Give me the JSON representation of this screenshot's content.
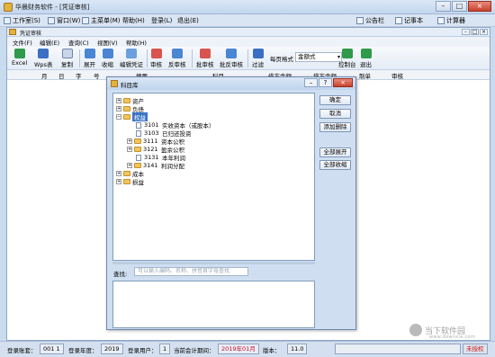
{
  "window": {
    "title": "华晨财务软件 - [凭证审核]"
  },
  "main_menu": [
    "工作室(S)",
    "窗口(W)",
    "主菜单(M)",
    "帮助(H)",
    "登录(L)",
    "退出(E)"
  ],
  "right_apps": [
    "公告栏",
    "记事本",
    "计算器"
  ],
  "doc_window": {
    "title": "凭证审核"
  },
  "sub_menu": [
    "文件(F)",
    "编辑(E)",
    "查询(C)",
    "视图(V)",
    "帮助(H)"
  ],
  "toolbar": {
    "buttons": [
      "Excel",
      "Wps表",
      "复制",
      "展开",
      "收缩",
      "编辑凭证",
      "审核",
      "反审核",
      "批审核",
      "批反审核",
      "过滤"
    ],
    "page_format_label": "每页格式",
    "format_value": "金额式",
    "right_buttons": [
      "控制台",
      "退出"
    ]
  },
  "columns": [
    "月",
    "日",
    "字",
    "号",
    "摘要",
    "科目",
    "借方金额",
    "贷方金额",
    "制单",
    "审核"
  ],
  "dialog": {
    "title": "科目库",
    "tree": [
      {
        "label": "资产",
        "expander": "+"
      },
      {
        "label": "负债",
        "expander": "+"
      },
      {
        "label": "权益",
        "expander": "−",
        "selected": true
      },
      {
        "code": "3101",
        "label": "实收资本（或股本）"
      },
      {
        "code": "3103",
        "label": "已归还投资"
      },
      {
        "code": "3111",
        "label": "资本公积",
        "expander": "+"
      },
      {
        "code": "3121",
        "label": "盈余公积",
        "expander": "+"
      },
      {
        "code": "3131",
        "label": "本年利润"
      },
      {
        "code": "3141",
        "label": "利润分配",
        "expander": "+"
      },
      {
        "label": "成本",
        "expander": "+"
      },
      {
        "label": "损益",
        "expander": "+"
      }
    ],
    "search_label": "查找:",
    "search_placeholder": "可以输入编码、名称、拼音首字母查找",
    "buttons": [
      "确定",
      "取消",
      "添加删除",
      "全部展开",
      "全部收缩"
    ]
  },
  "status": {
    "account_label": "登录账套：",
    "account_value": "001 1",
    "year_label": "登录年度：",
    "year_value": "2019",
    "user_label": "登录用户：",
    "user_value": "1",
    "period_label": "当前会计期间：",
    "period_value": "2019年01月",
    "version_label": "版本：",
    "version_value": "11.0",
    "reg_status": "未授权"
  },
  "watermark": {
    "text": "当下软件园",
    "sub": "www.downxia.com"
  },
  "colors": {
    "selection": "#3a73c9",
    "period_red": "#c8102e",
    "folder": "#f2c55c"
  }
}
